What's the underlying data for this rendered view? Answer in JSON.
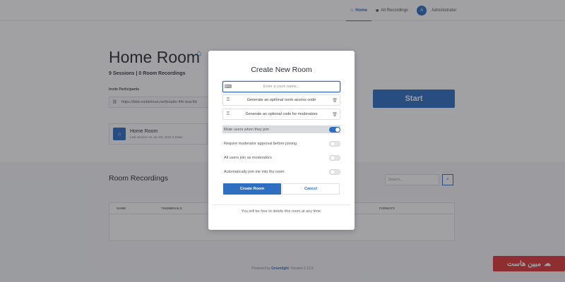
{
  "navbar": {
    "home_label": "Home",
    "recordings_label": "All Recordings",
    "user_initial": "A",
    "user_name": "Administrator"
  },
  "room": {
    "title": "Home Room",
    "stats": "9 Sessions | 0 Room Recordings",
    "invite_label": "Invite Participants",
    "invite_url": "https://bbb.mobinhost.net/b/adm-44r-dsa-fld",
    "start_label": "Start",
    "card_title": "Home Room",
    "card_subtitle": "Last session on Jun 28, 2022 2:19am"
  },
  "recordings": {
    "title": "Room Recordings",
    "search_placeholder": "Search...",
    "columns": [
      "NAME",
      "THUMBNAILS",
      "FORMATS"
    ]
  },
  "footer": {
    "prefix": "Powered by",
    "brand": "Greenlight",
    "suffix": ". Version 2.12.6"
  },
  "watermark": {
    "text": "مبین هاست"
  },
  "modal": {
    "title": "Create New Room",
    "name_placeholder": "Enter a room name...",
    "access_code_label": "Generate an optional room access code",
    "moderator_code_label": "Generate an optional code for moderators",
    "settings": [
      {
        "label": "Mute users when they join",
        "on": true
      },
      {
        "label": "Require moderator approval before joining",
        "on": false
      },
      {
        "label": "All users join as moderators",
        "on": false
      },
      {
        "label": "Automatically join me into the room",
        "on": false
      }
    ],
    "create_label": "Create Room",
    "cancel_label": "Cancel",
    "note": "You will be free to delete this room at any time."
  },
  "colors": {
    "accent": "#2f6fc2",
    "overlay": "#1e2026",
    "watermark": "#e13a3a"
  },
  "icons": [
    "home-icon",
    "video-icon",
    "key-icon",
    "link-icon",
    "trash-icon",
    "search-icon",
    "room-name-icon"
  ]
}
